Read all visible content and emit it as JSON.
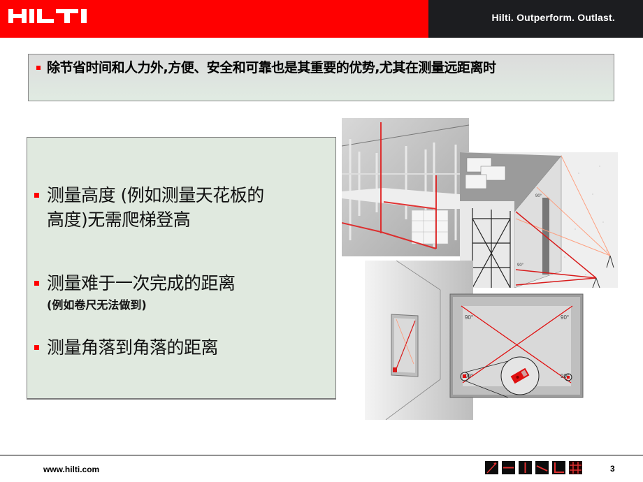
{
  "header": {
    "logo_text": "HILTI",
    "tagline": "Hilti. Outperform. Outlast.",
    "colors": {
      "brand_red": "#ff0000",
      "dark": "#1c1d20"
    }
  },
  "intro": {
    "text": "除节省时间和人力外,方便、安全和可靠也是其重要的优势,尤其在测量远距离时"
  },
  "bullets": [
    {
      "text_line1": "测量高度 (例如测量天花板的",
      "text_line2": "高度)无需爬梯登高"
    },
    {
      "text": "测量难于一次完成的距离",
      "sub": "(例如卷尺无法做到)"
    },
    {
      "text": "测量角落到角落的距离"
    }
  ],
  "illustrations": {
    "warehouse": "warehouse-shelving-height-measurement",
    "building": "building-facade-measurement",
    "room": "room-corner-to-corner-measurement",
    "angle_labels": [
      "90°",
      "90°",
      "90°",
      "90°"
    ],
    "small_angle_labels": [
      "90°",
      "90°"
    ]
  },
  "footer": {
    "url": "www.hilti.com",
    "page_number": "3",
    "icons": [
      "diagonal-line-icon",
      "horizontal-line-icon",
      "vertical-line-icon",
      "slope-line-icon",
      "corner-line-icon",
      "grid-icon"
    ]
  }
}
